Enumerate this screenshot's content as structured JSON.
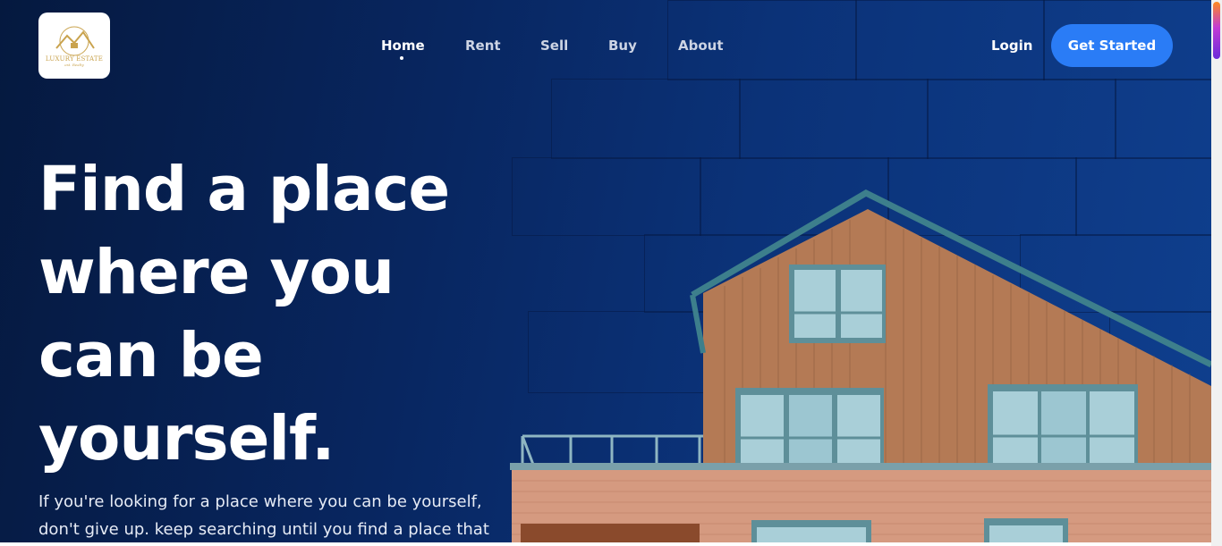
{
  "header": {
    "logo_text": "LUXURY ESTATE",
    "logo_sub": "est. Realty",
    "nav": [
      {
        "label": "Home",
        "active": true
      },
      {
        "label": "Rent",
        "active": false
      },
      {
        "label": "Sell",
        "active": false
      },
      {
        "label": "Buy",
        "active": false
      },
      {
        "label": "About",
        "active": false
      }
    ],
    "login_label": "Login",
    "cta_label": "Get Started"
  },
  "hero": {
    "title": "Find a place where you can be yourself.",
    "text": "If you're looking for a place where you can be yourself, don't give up. keep searching until you find a place that"
  },
  "colors": {
    "background_dark": "#05193f",
    "background_blue": "#0f3f8e",
    "cta": "#2a7cf6",
    "logo_gold": "#c9a34e",
    "wood": "#b47a55",
    "brick": "#d59a80",
    "roof_trim": "#3d7f8c"
  }
}
